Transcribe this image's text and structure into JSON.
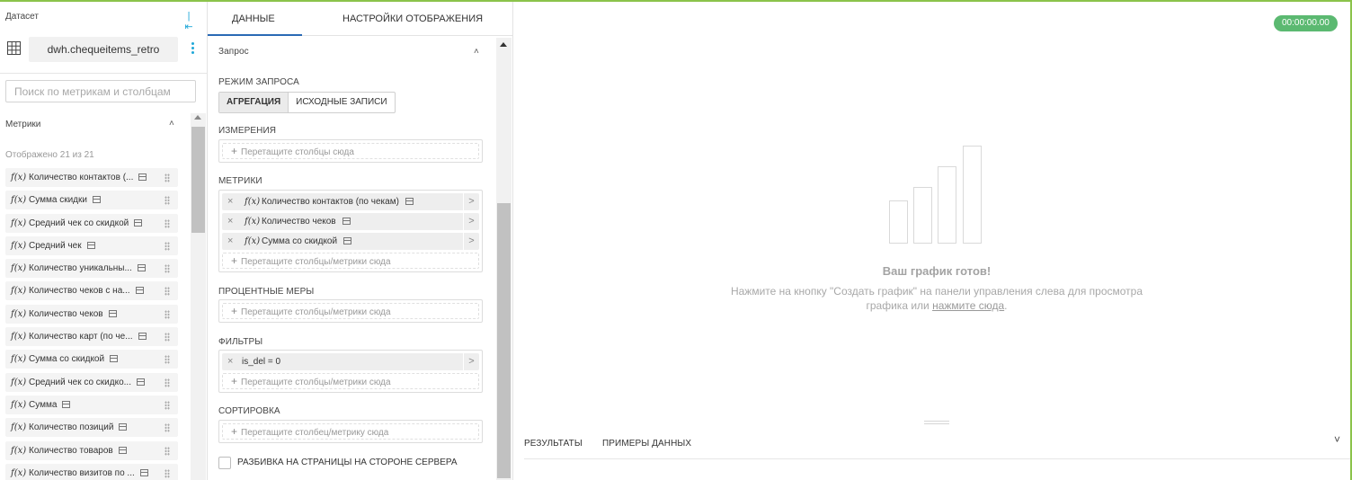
{
  "dataset": {
    "label": "Датасет",
    "name": "dwh.chequeitems_retro",
    "search_placeholder": "Поиск по метрикам и столбцам",
    "metrics_title": "Метрики",
    "shown_text": "Отображено 21 из 21",
    "fx_symbol": "f(x)",
    "metrics": [
      "Количество контактов (...",
      "Сумма скидки",
      "Средний чек со скидкой",
      "Средний чек",
      "Количество уникальны...",
      "Количество чеков с на...",
      "Количество чеков",
      "Количество карт (по че...",
      "Сумма со скидкой",
      "Средний чек со скидко...",
      "Сумма",
      "Количество позиций",
      "Количество товаров",
      "Количество визитов по ..."
    ]
  },
  "config": {
    "tabs": {
      "data": "ДАННЫЕ",
      "view": "НАСТРОЙКИ ОТОБРАЖЕНИЯ"
    },
    "query_title": "Запрос",
    "query_mode_title": "РЕЖИМ ЗАПРОСА",
    "mode_aggregation": "АГРЕГАЦИЯ",
    "mode_raw": "ИСХОДНЫЕ ЗАПИСИ",
    "dimensions_title": "ИЗМЕРЕНИЯ",
    "dimensions_placeholder": "Перетащите столбцы сюда",
    "metrics_title": "МЕТРИКИ",
    "selected_metrics": [
      "Количество контактов (по чекам)",
      "Количество чеков",
      "Сумма со скидкой"
    ],
    "metrics_placeholder": "Перетащите столбцы/метрики сюда",
    "percent_title": "ПРОЦЕНТНЫЕ МЕРЫ",
    "percent_placeholder": "Перетащите столбцы/метрики сюда",
    "filters_title": "ФИЛЬТРЫ",
    "filter": "is_del = 0",
    "filters_placeholder": "Перетащите столбцы/метрики сюда",
    "sort_title": "СОРТИРОВКА",
    "sort_placeholder": "Перетащите столбец/метрику сюда",
    "server_pagination_label": "РАЗБИВКА НА СТРАНИЦЫ НА СТОРОНЕ СЕРВЕРА",
    "server_pagination_checked": false
  },
  "preview": {
    "timer": "00:00:00.00",
    "ready_title": "Ваш график готов!",
    "hint_line1": "Нажмите на кнопку \"Создать график\" на панели управления слева для просмотра",
    "hint_line2_prefix": "графика или ",
    "hint_link": "нажмите сюда",
    "hint_line2_suffix": ".",
    "tab_results": "РЕЗУЛЬТАТЫ",
    "tab_samples": "ПРИМЕРЫ ДАННЫХ",
    "accent_color": "#8bc34a",
    "timer_color": "#5bb971"
  }
}
